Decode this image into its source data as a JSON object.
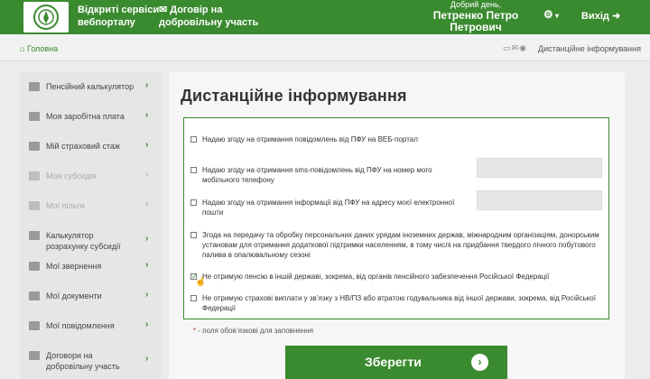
{
  "header": {
    "portal_line1": "Відкриті сервіси",
    "portal_line2": "вебпорталу",
    "voluntary_line1": "Договір на",
    "voluntary_line2": "добровільну участь",
    "greeting": "Добрий день,",
    "user_line1": "Петренко Петро",
    "user_line2": "Петрович",
    "exit_label": "Вихід",
    "brand_color": "#3a8a2f"
  },
  "breadcrumb": {
    "home_label": "Головна",
    "current": "Дистанційне інформування"
  },
  "sidebar": {
    "items": [
      {
        "label": "Пенсійний калькулятор",
        "icon": "calculator-icon"
      },
      {
        "label": "Моя заробітна плата",
        "icon": "wallet-icon"
      },
      {
        "label": "Мій страховий стаж",
        "icon": "calendar-icon"
      },
      {
        "label": "Моя субсидія",
        "icon": "folder-icon"
      },
      {
        "label": "Мої пільги",
        "icon": "folder-icon"
      },
      {
        "label": "Калькулятор розрахунку субсидії",
        "icon": "calculator-icon"
      },
      {
        "label": "Мої звернення",
        "icon": "mail-icon"
      },
      {
        "label": "Мої документи",
        "icon": "folder-icon"
      },
      {
        "label": "Мої повідомлення",
        "icon": "mail-icon"
      },
      {
        "label": "Договори на добровільну участь",
        "icon": "mail-icon"
      }
    ]
  },
  "main": {
    "title": "Дистанційне інформування",
    "options": [
      {
        "text": "Надаю згоду на отримання повідомлень від ПФУ на ВЕБ-портал",
        "checked": false
      },
      {
        "text": "Надаю згоду на отримання sms-повідомлень від ПФУ на номер мого мобільного телефону",
        "checked": false,
        "field_value": ""
      },
      {
        "text": "Надаю згоду на отримання інформації від ПФУ на адресу моєї електронної пошти",
        "checked": false,
        "field_value": ""
      },
      {
        "text": "Згода на передачу та обробку персональних даних урядам іноземних держав, міжнародним організаціям, донорським установам для отримання додаткової підтримки населенням, в тому числі на придбання твердого пічного побутового палива в опалювальному сезоні",
        "checked": false
      },
      {
        "text": "Не отримую пенсію в іншій державі, зокрема, від органів пенсійного забезпечення Російської Федерації",
        "checked": true
      },
      {
        "text": "Не отримую страхові виплати у зв’язку з НВ/ПЗ або втратою годувальника від іншої держави, зокрема, від Російської Федерації",
        "checked": false
      }
    ],
    "required_star": "*",
    "required_note": "- поля обов’язкові для заповнення",
    "save_label": "Зберегти"
  }
}
